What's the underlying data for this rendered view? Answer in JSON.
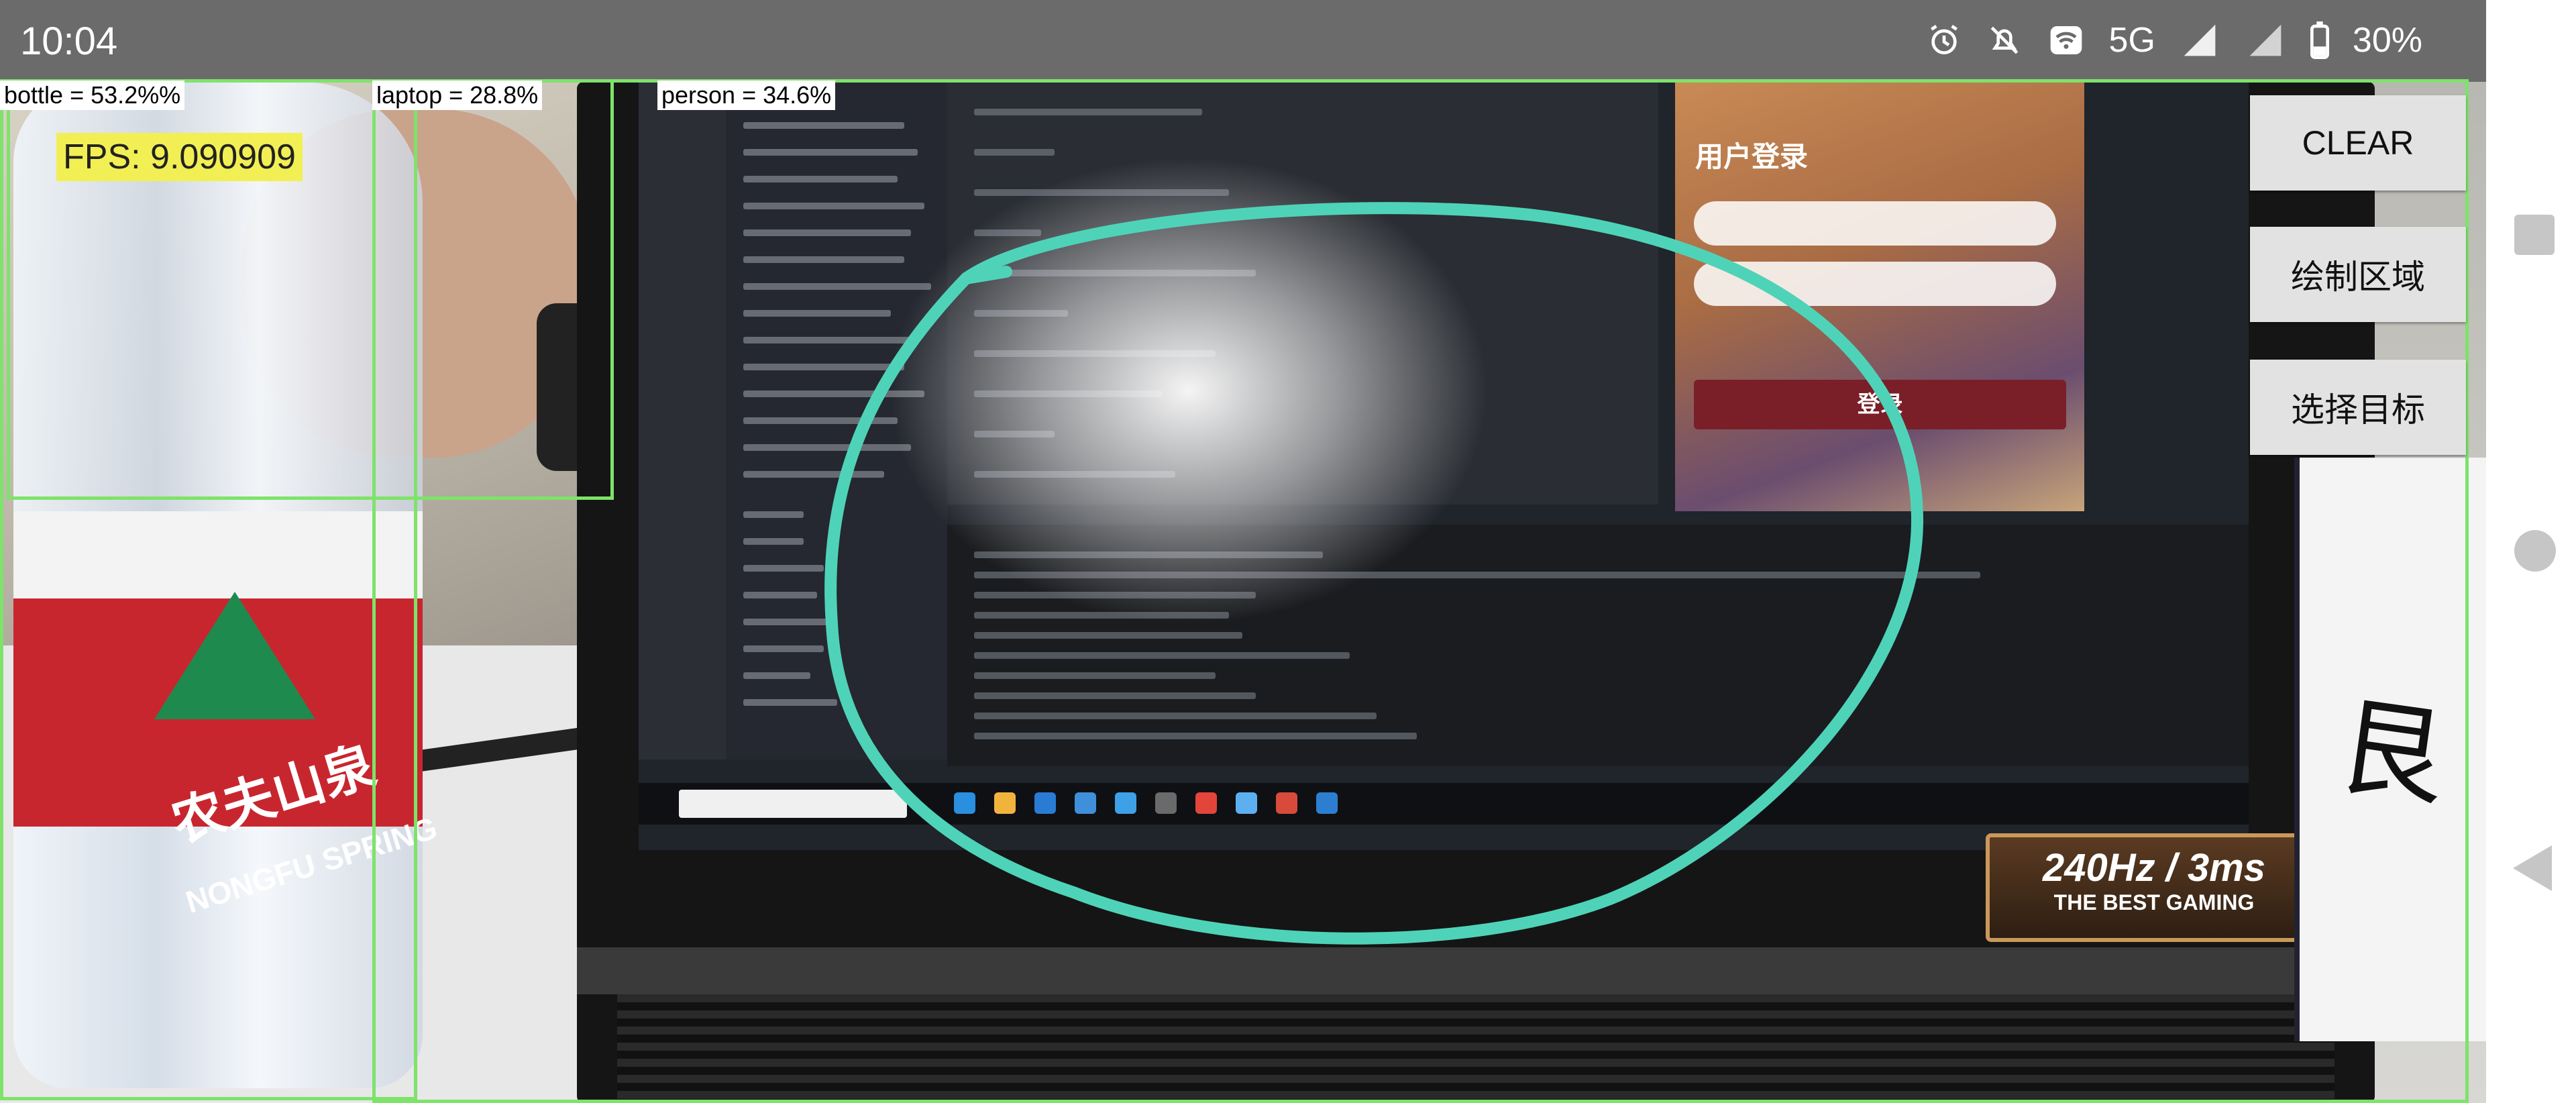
{
  "status_bar": {
    "time": "10:04",
    "network": "5G",
    "battery": "30%",
    "icons": [
      "alarm-icon",
      "notifications-off-icon",
      "wifi-calling-icon",
      "signal-icon",
      "signal-icon",
      "battery-icon"
    ]
  },
  "fps_label": "FPS: 9.090909",
  "detections": [
    {
      "label": "bottle = 53.2%%"
    },
    {
      "label": "laptop = 28.8%"
    },
    {
      "label": "person = 34.6%"
    }
  ],
  "buttons": {
    "clear": "CLEAR",
    "draw_region": "绘制区域",
    "select_target": "选择目标"
  },
  "scene_text": {
    "login_title": "用户登录",
    "login_button": "登录",
    "bottle_brand": "农夫山泉",
    "bottle_sub": "NONGFU SPRING",
    "badge_main": "240Hz / 3ms",
    "badge_sub": "THE BEST GAMING",
    "right_char": "艮"
  },
  "colors": {
    "detection_box": "#7ee36a",
    "drawn_region": "#4fd3b8",
    "fps_background": "#f2ef54",
    "status_bar": "#6b6b6b"
  }
}
